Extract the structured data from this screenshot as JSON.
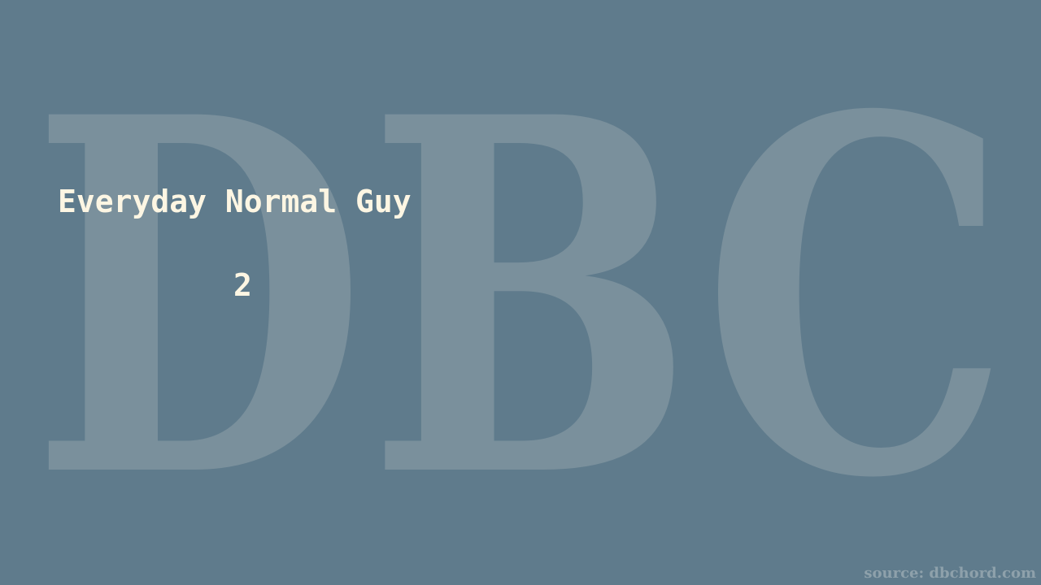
{
  "watermark": {
    "text": "DBC",
    "color": "#7a909c"
  },
  "slide": {
    "title": "Everyday Normal Guy",
    "number": "2"
  },
  "footer": {
    "source": "source: dbchord.com",
    "color": "#8ea1ab"
  },
  "colors": {
    "background": "#5f7b8c",
    "text": "#fdf6e3"
  }
}
